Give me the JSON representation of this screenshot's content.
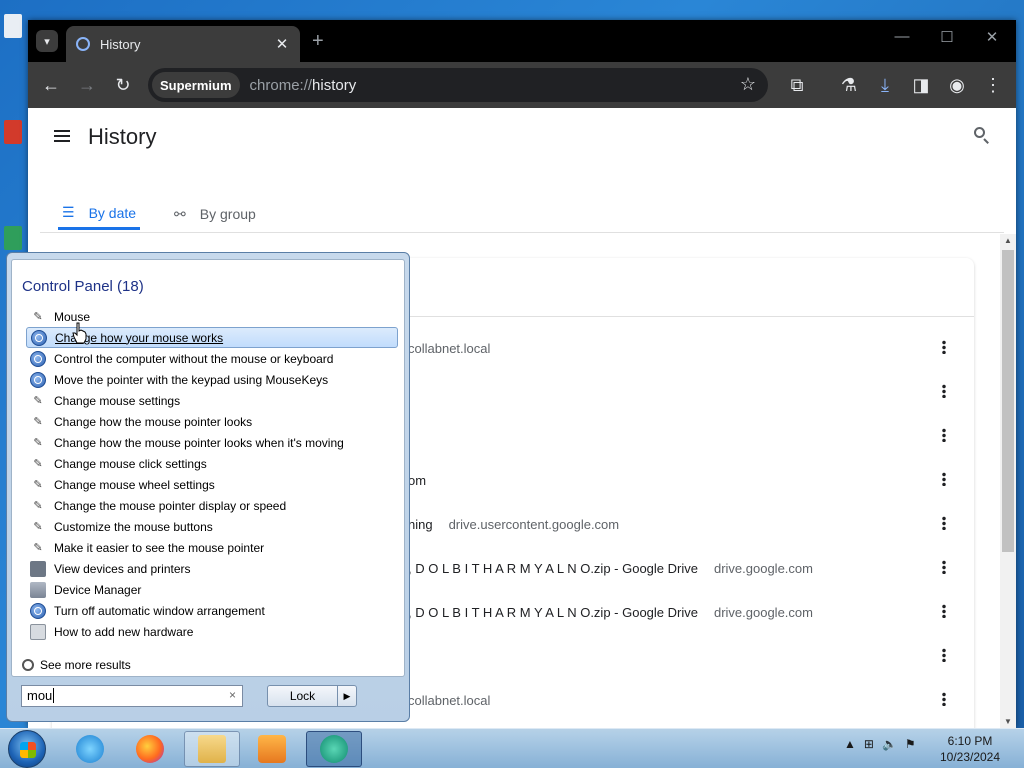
{
  "browser": {
    "tab_title": "History",
    "new_tab_symbol": "+",
    "window_controls": {
      "minimize": "—",
      "maximize": "☐",
      "close": "✕"
    },
    "omnibox": {
      "chip": "Supermium",
      "scheme": "chrome://",
      "host": "history"
    }
  },
  "history": {
    "title": "History",
    "tabs": [
      {
        "label": "By date"
      },
      {
        "label": "By group"
      }
    ],
    "rows": [
      {
        "title": "",
        "domain": "collabnet.local"
      },
      {
        "title": "",
        "domain": ""
      },
      {
        "title": "",
        "domain": ""
      },
      {
        "title": "om",
        "domain": ""
      },
      {
        "title": "ning",
        "domain": "drive.usercontent.google.com"
      },
      {
        "title": ", D O L B I T H A R M Y A L N O.zip - Google Drive",
        "domain": "drive.google.com"
      },
      {
        "title": ", D O L B I T H A R M Y A L N O.zip - Google Drive",
        "domain": "drive.google.com"
      },
      {
        "title": "",
        "domain": ""
      },
      {
        "title": "collabnet.local",
        "domain": ""
      }
    ]
  },
  "start_menu": {
    "header": "Control Panel (18)",
    "items": [
      {
        "label": "Mouse",
        "icon": "mouse-icon"
      },
      {
        "label": "Change how your mouse works",
        "icon": "ease-of-access-icon",
        "selected": true
      },
      {
        "label": "Control the computer without the mouse or keyboard",
        "icon": "ease-of-access-icon"
      },
      {
        "label": "Move the pointer with the keypad using MouseKeys",
        "icon": "ease-of-access-icon"
      },
      {
        "label": "Change mouse settings",
        "icon": "mouse-icon"
      },
      {
        "label": "Change how the mouse pointer looks",
        "icon": "mouse-icon"
      },
      {
        "label": "Change how the mouse pointer looks when it's moving",
        "icon": "mouse-icon"
      },
      {
        "label": "Change mouse click settings",
        "icon": "mouse-icon"
      },
      {
        "label": "Change mouse wheel settings",
        "icon": "mouse-icon"
      },
      {
        "label": "Change the mouse pointer display or speed",
        "icon": "mouse-icon"
      },
      {
        "label": "Customize the mouse buttons",
        "icon": "mouse-icon"
      },
      {
        "label": "Make it easier to see the mouse pointer",
        "icon": "mouse-icon"
      },
      {
        "label": "View devices and printers",
        "icon": "printer-icon"
      },
      {
        "label": "Device Manager",
        "icon": "device-manager-icon"
      },
      {
        "label": "Turn off automatic window arrangement",
        "icon": "ease-of-access-icon"
      },
      {
        "label": "How to add new hardware",
        "icon": "hardware-icon"
      }
    ],
    "see_more": "See more results",
    "search_value": "mou",
    "clear_symbol": "×",
    "lock_label": "Lock"
  },
  "taskbar": {
    "time": "6:10 PM",
    "date": "10/23/2024"
  }
}
